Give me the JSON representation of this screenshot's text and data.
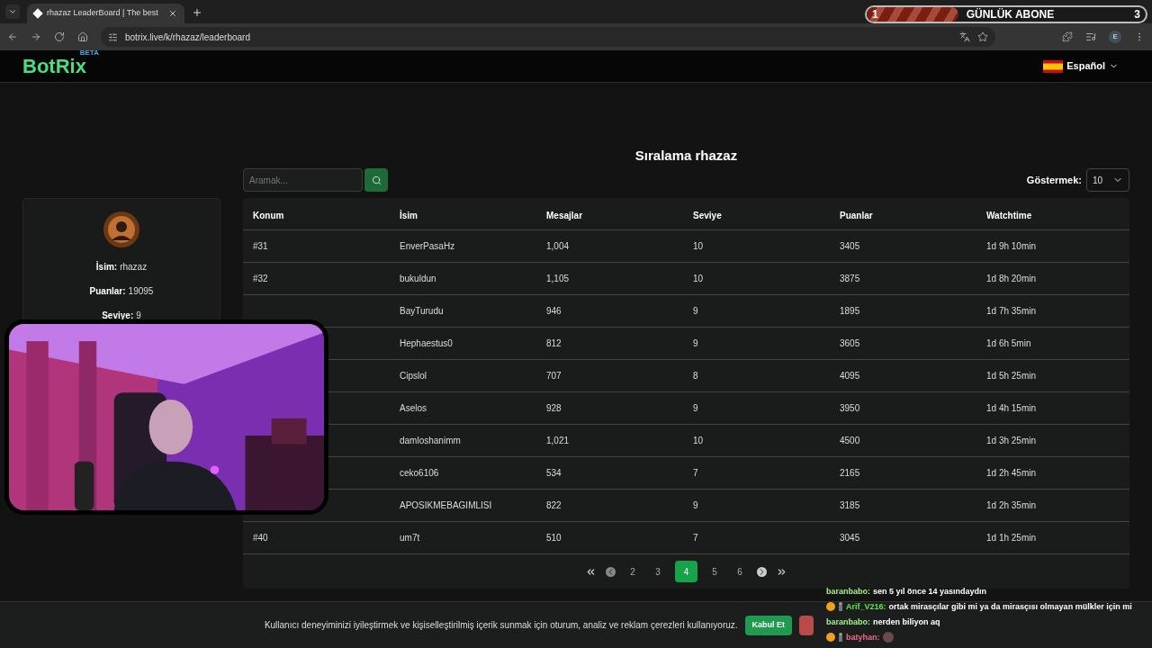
{
  "browser": {
    "tab_title": "rhazaz LeaderBoard | The best",
    "url": "botrix.live/k/rhazaz/leaderboard",
    "profile_initial": "E"
  },
  "site": {
    "logo": "BotRix",
    "logo_badge": "BETA",
    "language": "Español"
  },
  "title": "Sıralama rhazaz",
  "search": {
    "placeholder": "Aramak..."
  },
  "show": {
    "label": "Göstermek:",
    "value": "10"
  },
  "profile": [
    {
      "label": "İsim:",
      "value": "rhazaz"
    },
    {
      "label": "Puanlar:",
      "value": "19095"
    },
    {
      "label": "Seviye:",
      "value": "9"
    }
  ],
  "table": {
    "columns": [
      "Konum",
      "İsim",
      "Mesajlar",
      "Seviye",
      "Puanlar",
      "Watchtime"
    ],
    "rows": [
      {
        "konum": "#31",
        "name": "EnverPasaHz",
        "messages": "1,004",
        "level": "10",
        "points": "3405",
        "watchtime": "1d 9h 10min"
      },
      {
        "konum": "#32",
        "name": "bukuldun",
        "messages": "1,105",
        "level": "10",
        "points": "3875",
        "watchtime": "1d 8h 20min"
      },
      {
        "name": "BayTurudu",
        "messages": "946",
        "level": "9",
        "points": "1895",
        "watchtime": "1d 7h 35min"
      },
      {
        "name": "Hephaestus0",
        "messages": "812",
        "level": "9",
        "points": "3605",
        "watchtime": "1d 6h 5min"
      },
      {
        "name": "Cipslol",
        "messages": "707",
        "level": "8",
        "points": "4095",
        "watchtime": "1d 5h 25min"
      },
      {
        "name": "Aselos",
        "messages": "928",
        "level": "9",
        "points": "3950",
        "watchtime": "1d 4h 15min"
      },
      {
        "name": "damloshanimm",
        "messages": "1,021",
        "level": "10",
        "points": "4500",
        "watchtime": "1d 3h 25min"
      },
      {
        "name": "ceko6106",
        "messages": "534",
        "level": "7",
        "points": "2165",
        "watchtime": "1d 2h 45min"
      },
      {
        "name": "APOSIKMEBAGIMLISI",
        "messages": "822",
        "level": "9",
        "points": "3185",
        "watchtime": "1d 2h 35min"
      },
      {
        "konum": "#40",
        "name": "um7t",
        "messages": "510",
        "level": "7",
        "points": "3045",
        "watchtime": "1d 1h 25min"
      }
    ]
  },
  "pagination": [
    {
      "label": "2",
      "selected": false
    },
    {
      "label": "3",
      "selected": false
    },
    {
      "label": "4",
      "selected": true
    },
    {
      "label": "5",
      "selected": false
    },
    {
      "label": "6",
      "selected": false
    }
  ],
  "cookie": {
    "text": "Kullanıcı deneyiminizi iyileştirmek ve kişiselleştirilmiş içerik sunmak için oturum, analiz ve reklam çerezleri kullanıyoruz.",
    "accept": "Kabul Et"
  },
  "stream_goal": {
    "start": "1",
    "label": "GÜNLÜK ABONE",
    "end": "3",
    "level": 0.33
  },
  "chat": [
    {
      "user": "baranbabo:",
      "text": "sen 5 yıl önce 14 yasındaydın",
      "color": "#a6f08c",
      "badges": false
    },
    {
      "user": "Arif_V216:",
      "text": "ortak mirasçılar gibi mi ya da mirasçısı olmayan mülkler için mi",
      "color": "#5ee84a",
      "badges": true
    },
    {
      "user": "baranbabo:",
      "text": "nerden biliyon aq",
      "color": "#a6f08c",
      "badges": false
    },
    {
      "user": "batyhan:",
      "color": "#f06a8a",
      "badges": true
    }
  ]
}
